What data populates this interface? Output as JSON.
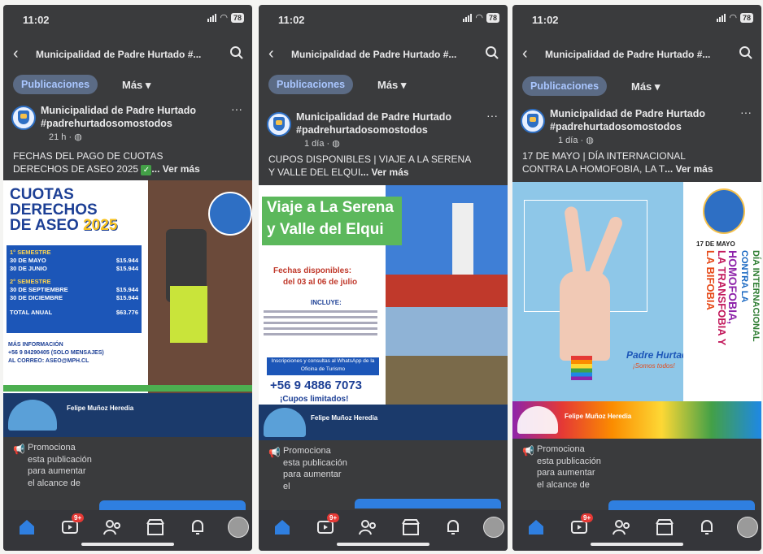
{
  "screens": [
    {
      "status": {
        "time": "11:02",
        "battery": "78"
      },
      "topbar": {
        "title": "Municipalidad de Padre Hurtado #..."
      },
      "tabs": {
        "active": "Publicaciones",
        "more": "Más ▾"
      },
      "post": {
        "author_line1": "Municipalidad de Padre Hurtado",
        "author_line2": "#padrehurtadosomostodos",
        "meta": "21 h · ",
        "text1": "FECHAS DEL PAGO DE CUOTAS",
        "text2": "DERECHOS DE ASEO 2025 ",
        "see_more": "... Ver más"
      },
      "promo": {
        "text": "Promociona esta publicación para aumentar el alcance de"
      },
      "nav": {
        "badge": "9+"
      }
    },
    {
      "status": {
        "time": "11:02",
        "battery": "78"
      },
      "topbar": {
        "title": "Municipalidad de Padre Hurtado #..."
      },
      "tabs": {
        "active": "Publicaciones",
        "more": "Más ▾"
      },
      "post": {
        "author_line1": "Municipalidad de Padre Hurtado",
        "author_line2": "#padrehurtadosomostodos",
        "meta": "1 día · ",
        "text1": "CUPOS DISPONIBLES | VIAJE A LA SERENA",
        "text2": "Y VALLE DEL ELQUI",
        "see_more": "... Ver más"
      },
      "promo": {
        "text": "Promociona esta publicación para aumentar el"
      },
      "nav": {
        "badge": "9+"
      }
    },
    {
      "status": {
        "time": "11:02",
        "battery": "78"
      },
      "topbar": {
        "title": "Municipalidad de Padre Hurtado #..."
      },
      "tabs": {
        "active": "Publicaciones",
        "more": "Más ▾"
      },
      "post": {
        "author_line1": "Municipalidad de Padre Hurtado",
        "author_line2": "#padrehurtadosomostodos",
        "meta": "1 día · ",
        "text1": "17 DE MAYO | DÍA INTERNACIONAL",
        "text2": "CONTRA LA HOMOFOBIA, LA T",
        "see_more": "... Ver más"
      },
      "promo": {
        "text": "Promociona esta publicación para aumentar el alcance de"
      },
      "nav": {
        "badge": "9+"
      }
    }
  ],
  "poster1": {
    "title1": "CUOTAS",
    "title2": "DERECHOS",
    "title3": "DE ASEO",
    "year": "2025",
    "sem1": "1° SEMESTRE",
    "row1": "30 DE MAYO",
    "row1v": "$15.944",
    "row2": "30 DE JUNIO",
    "row2v": "$15.944",
    "sem2": "2° SEMESTRE",
    "row3": "30 DE SEPTIEMBRE",
    "row3v": "$15.944",
    "row4": "30 DE DICIEMBRE",
    "row4v": "$15.944",
    "total": "TOTAL ANUAL",
    "totalv": "$63.776",
    "info": "MÁS INFORMACIÓN",
    "phone": "+56 9 84290405 (SOLO MENSAJES)",
    "email": "AL CORREO: ASEO@MPH.CL",
    "signer": "Felipe Muñoz Heredia"
  },
  "poster2": {
    "title1": "Viaje a La Serena",
    "title2": "y Valle del Elqui",
    "dates_title": "Fechas disponibles:",
    "dates": "del 03 al 06 de julio",
    "includes": "INCLUYE:",
    "inscripciones": "Inscripciones y consultas al WhatsApp de la Oficina de Turismo",
    "phone": "+56 9 4886 7073",
    "cupos": "¡Cupos limitados!",
    "signer": "Felipe Muñoz Heredia"
  },
  "poster3": {
    "date": "17 DE MAYO",
    "v1": "DÍA INTERNACIONAL",
    "v2": "CONTRA LA",
    "v3": "HOMOFOBIA,",
    "v4": "LA TRANSFOBIA Y",
    "v5": "LA BIFOBIA",
    "brand": "Padre Hurtado",
    "slogan": "¡Somos todos!",
    "signer": "Felipe Muñoz Heredia"
  },
  "colors": {
    "bg": "#3a3b3d",
    "accent": "#2f7fe0",
    "tab_bg": "#5b6b85",
    "badge": "#e53935"
  }
}
